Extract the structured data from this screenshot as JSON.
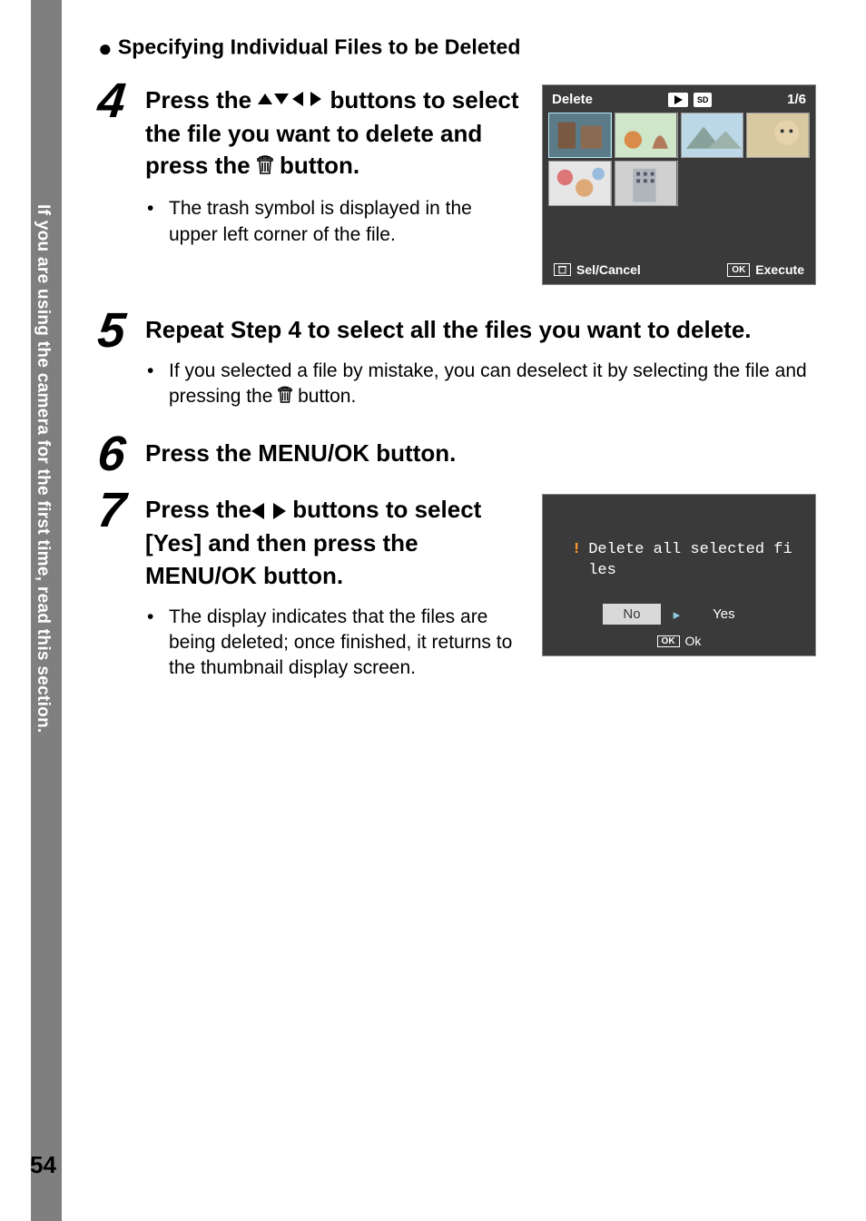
{
  "side_label": "If you are using the camera for the first time, read this section.",
  "subheading_bullet": "●",
  "subheading": "Specifying Individual Files to be Deleted",
  "steps": {
    "s4": {
      "num": "4",
      "title_a": "Press the ",
      "title_b": " buttons to select the file you want to delete and press the ",
      "title_c": " button.",
      "bullet": "The trash symbol is displayed in the upper left corner of the file."
    },
    "s5": {
      "num": "5",
      "title": "Repeat Step 4 to select all the files you want to delete.",
      "bullet_a": "If you selected a file by mistake, you can deselect it by selecting the file and pressing the ",
      "bullet_b": " button."
    },
    "s6": {
      "num": "6",
      "title": "Press the MENU/OK button."
    },
    "s7": {
      "num": "7",
      "title_a": "Press the",
      "title_b": " buttons to select [Yes] and then press the MENU/OK button.",
      "bullet": "The display indicates that the files are being deleted; once finished, it returns to the thumbnail display screen."
    }
  },
  "cam": {
    "title": "Delete",
    "counter": "1/6",
    "sd": "SD",
    "footer_left": "Sel/Cancel",
    "footer_right": "Execute",
    "ok": "OK"
  },
  "confirm": {
    "msg_line": "Delete all selected fi",
    "msg_line2": "les",
    "no": "No",
    "yes": "Yes",
    "ok": "OK",
    "ok_label": "Ok"
  },
  "page_number": "54"
}
